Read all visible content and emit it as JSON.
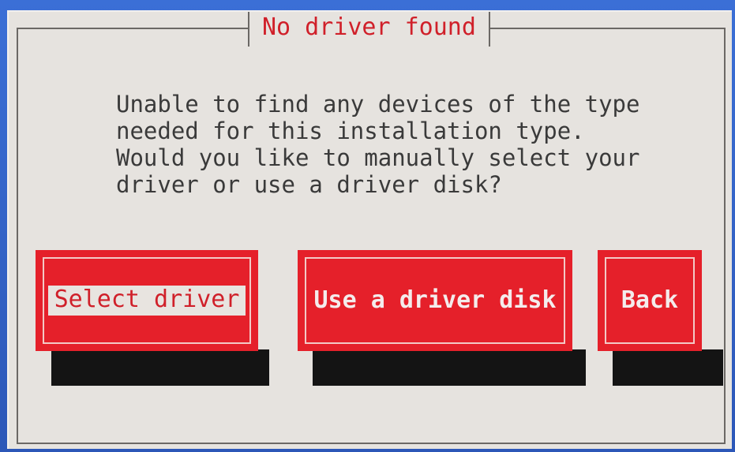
{
  "dialog": {
    "title": "No driver found",
    "message": "Unable to find any devices of the type\nneeded for this installation type.\nWould you like to manually select your\ndriver or use a driver disk?"
  },
  "buttons": {
    "select_driver": "Select driver",
    "use_driver_disk": "Use a driver disk",
    "back": "Back"
  },
  "colors": {
    "background": "#e6e3df",
    "button_red": "#e5202a",
    "title_red": "#d0202a",
    "shadow": "#141414"
  },
  "focused_button": "Select driver"
}
